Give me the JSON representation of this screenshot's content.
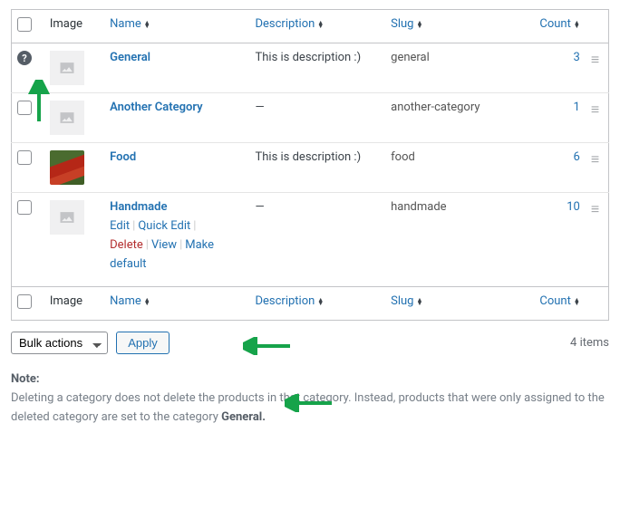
{
  "columns": {
    "image": "Image",
    "name": "Name",
    "description": "Description",
    "slug": "Slug",
    "count": "Count"
  },
  "rows": [
    {
      "name": "General",
      "description": "This is description :)",
      "slug": "general",
      "count": "3",
      "has_photo": false,
      "show_help": true,
      "show_actions": false
    },
    {
      "name": "Another Category",
      "description": "—",
      "slug": "another-category",
      "count": "1",
      "has_photo": false,
      "show_help": false,
      "show_actions": false
    },
    {
      "name": "Food",
      "description": "This is description :)",
      "slug": "food",
      "count": "6",
      "has_photo": true,
      "show_help": false,
      "show_actions": false
    },
    {
      "name": "Handmade",
      "description": "—",
      "slug": "handmade",
      "count": "10",
      "has_photo": false,
      "show_help": false,
      "show_actions": true
    }
  ],
  "row_actions": {
    "edit": "Edit",
    "quick_edit": "Quick Edit",
    "delete": "Delete",
    "view": "View",
    "make_default": "Make default"
  },
  "bulk": {
    "label": "Bulk actions",
    "apply": "Apply"
  },
  "items_count": "4 items",
  "note": {
    "title": "Note:",
    "body_before": "Deleting a category does not delete the products in that category. Instead, products that were only assigned to the deleted category are set to the category ",
    "body_strong": "General.",
    "body_after": ""
  }
}
